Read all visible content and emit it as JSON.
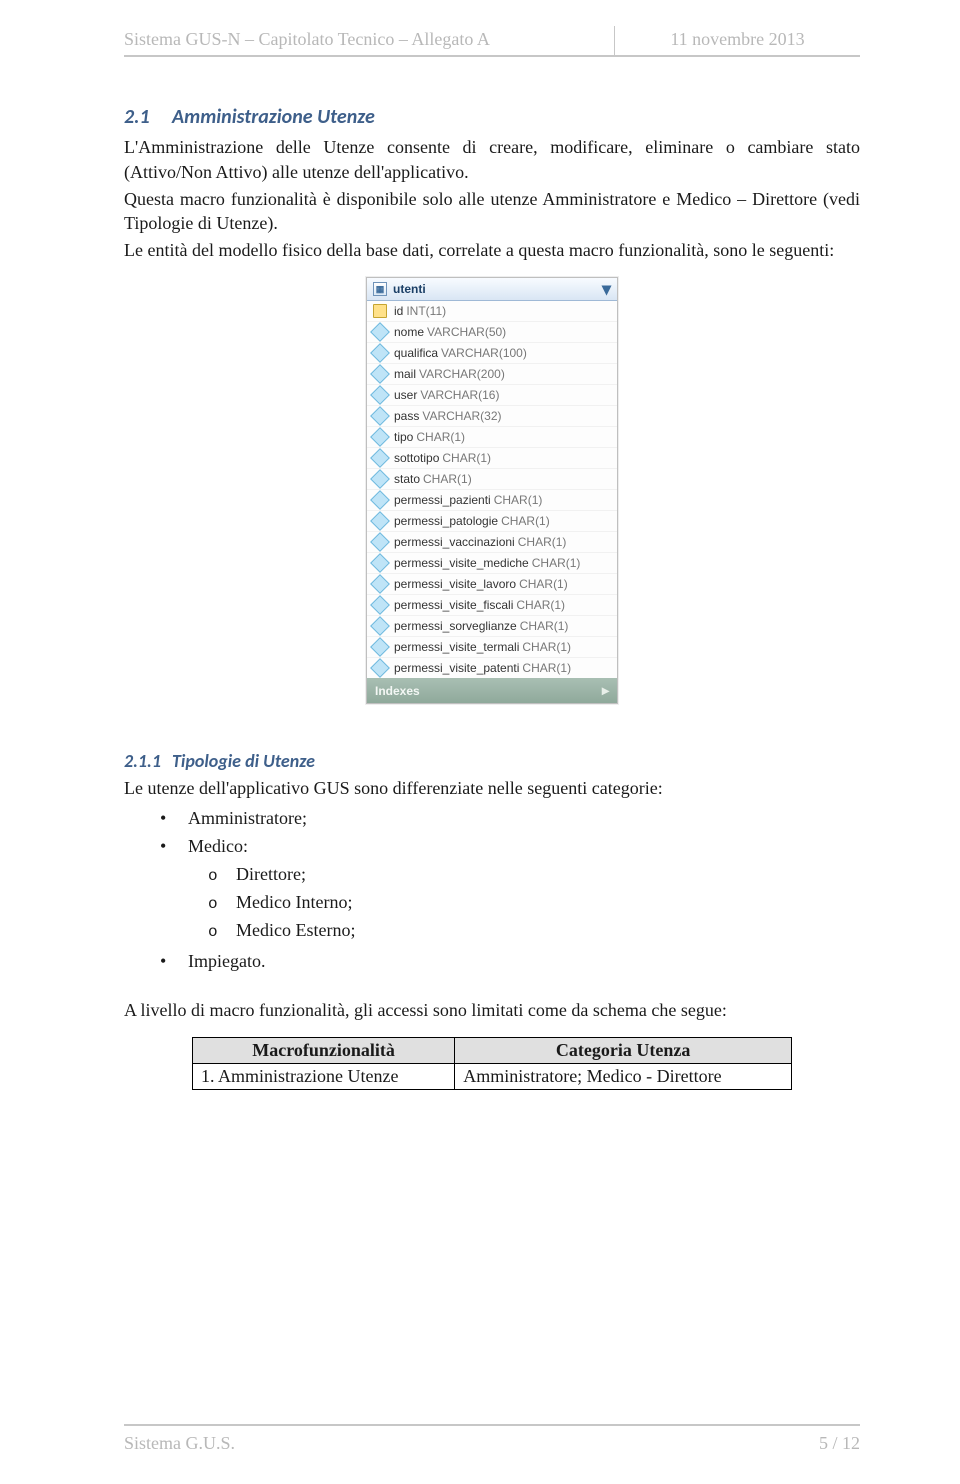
{
  "header": {
    "left": "Sistema GUS-N – Capitolato Tecnico – Allegato A",
    "right": "11 novembre 2013"
  },
  "sec21": {
    "num": "2.1",
    "title": "Amministrazione Utenze",
    "p1": "L'Amministrazione delle Utenze consente di creare, modificare, eliminare o cambiare stato (Attivo/Non Attivo) alle utenze dell'applicativo.",
    "p2": "Questa macro funzionalità è disponibile solo alle utenze Amministratore e Medico – Direttore (vedi Tipologie di Utenze).",
    "p3": "Le entità del modello fisico della base dati, correlate a questa macro funzionalità, sono le seguenti:"
  },
  "entity": {
    "name": "utenti",
    "indexes_label": "Indexes",
    "columns": [
      {
        "name": "id",
        "type": "INT(11)",
        "pk": true
      },
      {
        "name": "nome",
        "type": "VARCHAR(50)"
      },
      {
        "name": "qualifica",
        "type": "VARCHAR(100)"
      },
      {
        "name": "mail",
        "type": "VARCHAR(200)"
      },
      {
        "name": "user",
        "type": "VARCHAR(16)"
      },
      {
        "name": "pass",
        "type": "VARCHAR(32)"
      },
      {
        "name": "tipo",
        "type": "CHAR(1)"
      },
      {
        "name": "sottotipo",
        "type": "CHAR(1)"
      },
      {
        "name": "stato",
        "type": "CHAR(1)"
      },
      {
        "name": "permessi_pazienti",
        "type": "CHAR(1)"
      },
      {
        "name": "permessi_patologie",
        "type": "CHAR(1)"
      },
      {
        "name": "permessi_vaccinazioni",
        "type": "CHAR(1)"
      },
      {
        "name": "permessi_visite_mediche",
        "type": "CHAR(1)"
      },
      {
        "name": "permessi_visite_lavoro",
        "type": "CHAR(1)"
      },
      {
        "name": "permessi_visite_fiscali",
        "type": "CHAR(1)"
      },
      {
        "name": "permessi_sorveglianze",
        "type": "CHAR(1)"
      },
      {
        "name": "permessi_visite_termali",
        "type": "CHAR(1)"
      },
      {
        "name": "permessi_visite_patenti",
        "type": "CHAR(1)"
      }
    ]
  },
  "sec211": {
    "num": "2.1.1",
    "title": "Tipologie di Utenze",
    "intro": "Le utenze dell'applicativo GUS sono differenziate nelle seguenti categorie:",
    "items": [
      "Amministratore;",
      "Medico:",
      "Impiegato."
    ],
    "medico_sub": [
      "Direttore;",
      "Medico Interno;",
      "Medico Esterno;"
    ],
    "after": "A livello di macro funzionalità, gli accessi sono limitati come da schema che segue:"
  },
  "table": {
    "h1": "Macrofunzionalità",
    "h2": "Categoria Utenza",
    "rows": [
      {
        "c1": "1.   Amministrazione Utenze",
        "c2": "Amministratore; Medico - Direttore"
      }
    ]
  },
  "footer": {
    "left": "Sistema G.U.S.",
    "right": "5 / 12"
  }
}
